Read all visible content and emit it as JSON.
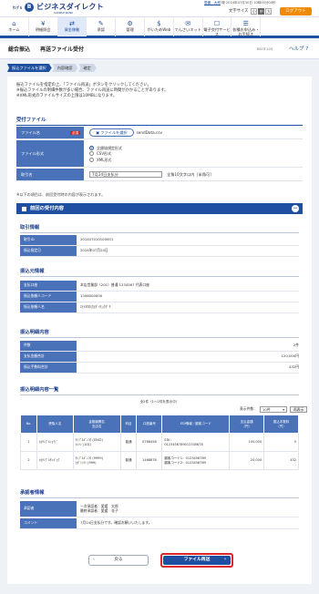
{
  "header": {
    "bank": "ｻﾝﾌﾟﾙ",
    "brand": "ビジネスダイレクト",
    "brand_sub": "SAMPLE BANK",
    "user": "愛媛　太郎",
    "user_suffix": "様",
    "last_login": "2014年07月30日 10時00分00秒",
    "font_size_label": "文字サイズ",
    "font_sizes": [
      "小",
      "中",
      "大"
    ],
    "logout": "ログアウト"
  },
  "nav": [
    {
      "icon": "home-icon",
      "glyph": "⌂",
      "label": "ホーム"
    },
    {
      "icon": "inquiry-icon",
      "glyph": "¥",
      "label": "明細照会"
    },
    {
      "icon": "fund-transfer-icon",
      "glyph": "⇄",
      "label": "資金移動"
    },
    {
      "icon": "approval-icon",
      "glyph": "✎",
      "label": "承認"
    },
    {
      "icon": "management-icon",
      "glyph": "⚙",
      "label": "管理"
    },
    {
      "icon": "gaitame-icon",
      "glyph": "$",
      "label": "がいためWeb"
    },
    {
      "icon": "densai-icon",
      "glyph": "✉",
      "label": "でんさいネット"
    },
    {
      "icon": "e-delivery-icon",
      "glyph": "☐",
      "label": "電子交付サービス"
    },
    {
      "icon": "application-icon",
      "glyph": "☰",
      "label": "各種お申込み・お手続き"
    }
  ],
  "title": {
    "main": "総合振込",
    "sub": "再送ファイル受付",
    "screen_id": "BSOF105",
    "help": "ヘルプ"
  },
  "steps": [
    "振込ファイルを選択",
    "内容確認",
    "確定"
  ],
  "description": [
    "振込ファイルを指定の上、「ファイル再送」ボタンをクリックしてください。",
    "※振込ファイルの明細件数が多い場合、ファイル再送に時間がかかることがあります。",
    "※XML形式のファイルサイズの上限は10MBになります。"
  ],
  "upload": {
    "section": "受付ファイル",
    "file_label": "ファイル名",
    "required": "必須",
    "file_button": "ファイルを選択",
    "file_value": "sendData.csv",
    "format_label": "ファイル形式",
    "formats": [
      "全銀協規定形式",
      "CSV形式",
      "XML形式"
    ],
    "memo_label": "取引名",
    "memo_value": "7月24日支払分",
    "memo_hint": "全角10文字以内［半角可］"
  },
  "note": "※以下の項目は、前回受付時の内容が表示されます。",
  "prev": {
    "bar": "前回の受付内容",
    "tx_section": "取引情報",
    "tx": [
      {
        "k": "取引ID",
        "v": "201407010100001"
      },
      {
        "k": "振込指定日",
        "v": "2014年07月24日"
      }
    ],
    "src_section": "振込元情報",
    "src": [
      {
        "k": "支払口座",
        "v": "本店営業部（201）普通 1234567 代表口座"
      },
      {
        "k": "振込依頼人コード",
        "v": "1306000000"
      },
      {
        "k": "振込依頼人名",
        "v": "ｴﾋﾒﾀﾛｳ(ｶ)ﾀﾞｲﾋｮｳｸﾞﾁ"
      }
    ],
    "sum_section": "振込明細内容",
    "sum": [
      {
        "k": "件数",
        "v": "2件"
      },
      {
        "k": "支払金額合計",
        "v": "120,000円"
      },
      {
        "k": "振込手数料合計",
        "v": "432円"
      }
    ],
    "list_section": "振込明細内容一覧",
    "count_text": "全2件（1～2件を表示中）",
    "page_size_label": "表示件数：",
    "page_size": "10件",
    "page_size_button": "再表示",
    "columns": [
      "No.",
      "受取人名",
      "金融機関名\n支店名",
      "科目",
      "口座番号",
      "EDI情報／顧客コード",
      "支払金額\n（円）",
      "振込手数料\n（円）"
    ],
    "rows": [
      {
        "no": "1",
        "name": "ｶ)ｻﾝﾌﾟﾙｼｮｳｼﾞ",
        "bank": "ｻﾝﾌﾟﾙｷﾞﾝｺｳ (0542)\nﾎﾝﾃﾝ (101)",
        "kind": "普通",
        "acct": "0768458",
        "edi": "EDI：\n0123456789012345678",
        "amt": "100,000",
        "fee": "0"
      },
      {
        "no": "2",
        "name": "ｶ)ｻﾝﾌﾟﾙｻﾝｷﾞｮｳ",
        "bank": "ｻﾝﾌﾟﾙｷﾞﾝｺｳ (9999)\nﾋｶﾞｼｼﾃﾝ (999)",
        "kind": "普通",
        "acct": "1468878",
        "edi": "顧客コード1：0123456789\n顧客コード2：0123456789",
        "amt": "20,000",
        "fee": "432"
      }
    ],
    "app_section": "承認者情報",
    "app": [
      {
        "k": "承認者",
        "v": "一次承認者：愛媛　太郎\n最終承認者：愛媛　花子"
      },
      {
        "k": "コメント",
        "v": "7月24日支払分です。確認お願いいたします。"
      }
    ]
  },
  "buttons": {
    "back": "戻る",
    "resend": "ファイル再送"
  }
}
